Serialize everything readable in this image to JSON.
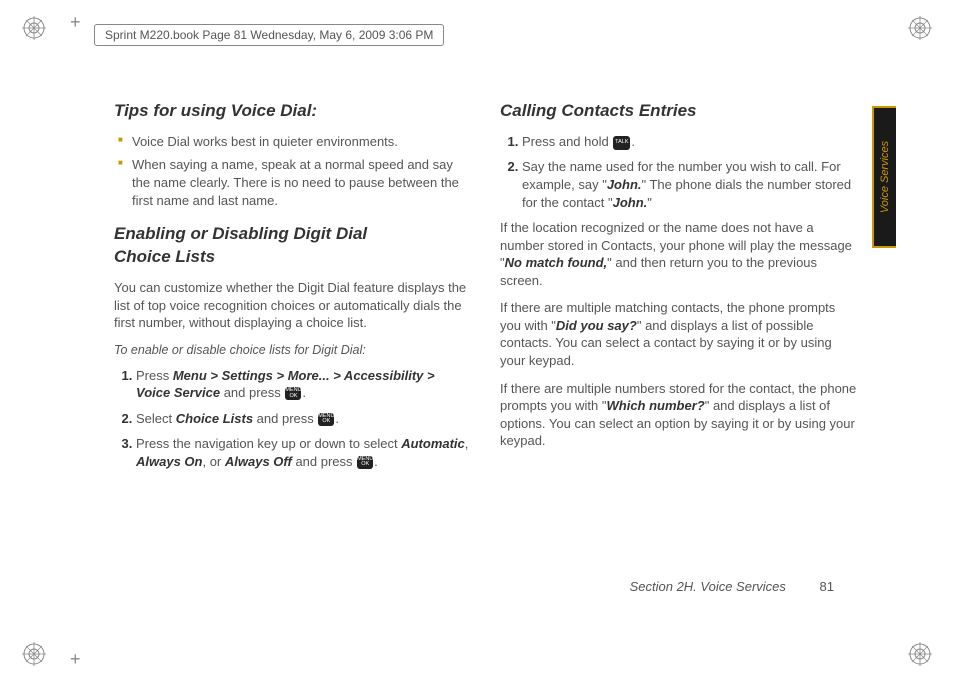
{
  "header": "Sprint M220.book  Page 81  Wednesday, May 6, 2009  3:06 PM",
  "side_tab": "Voice Services",
  "left": {
    "h1": "Tips for using Voice Dial:",
    "bullets": [
      "Voice Dial works best in quieter environments.",
      "When saying a name, speak at a normal speed and say the name clearly. There is no need to pause between the first name and last name."
    ],
    "h2a": "Enabling or Disabling Digit Dial",
    "h2b": "Choice Lists",
    "p1": "You can customize whether the Digit Dial feature displays the list of top voice recognition choices or automatically dials the first number, without displaying a choice list.",
    "instr": "To enable or disable choice lists for Digit Dial:",
    "steps": {
      "s1a": "Press ",
      "s1b": "Menu > Settings > More... > Accessibility > Voice Service",
      "s1c": " and press ",
      "s2a": "Select ",
      "s2b": "Choice Lists",
      "s2c": " and press ",
      "s3a": "Press the navigation key up or down to select ",
      "s3b": "Automatic",
      "s3c": ", ",
      "s3d": "Always On",
      "s3e": ", or ",
      "s3f": "Always Off",
      "s3g": " and press "
    }
  },
  "right": {
    "h1": "Calling Contacts Entries",
    "steps": {
      "s1": "Press and hold ",
      "s2a": "Say the name used for the number you wish to call. For example, say \"",
      "s2b": "John.",
      "s2c": "\" The phone dials the number stored for the contact \"",
      "s2d": "John.",
      "s2e": "\""
    },
    "p1a": "If the location recognized or the name does not have a number stored in Contacts, your phone will play the message \"",
    "p1b": "No match found,",
    "p1c": "\" and then return you to the previous screen.",
    "p2a": "If there are multiple matching contacts, the phone prompts you with \"",
    "p2b": "Did you say?",
    "p2c": "\" and displays a list of possible contacts. You can select a contact by saying it or by using your keypad.",
    "p3a": "If there are multiple numbers stored for the contact, the phone prompts you with \"",
    "p3b": "Which number?",
    "p3c": "\" and displays a list of options. You can select an option by saying it or by using your keypad."
  },
  "footer": {
    "section": "Section 2H. Voice Services",
    "page": "81"
  },
  "icons": {
    "menu_ok": "MENU OK",
    "talk": "TALK"
  }
}
